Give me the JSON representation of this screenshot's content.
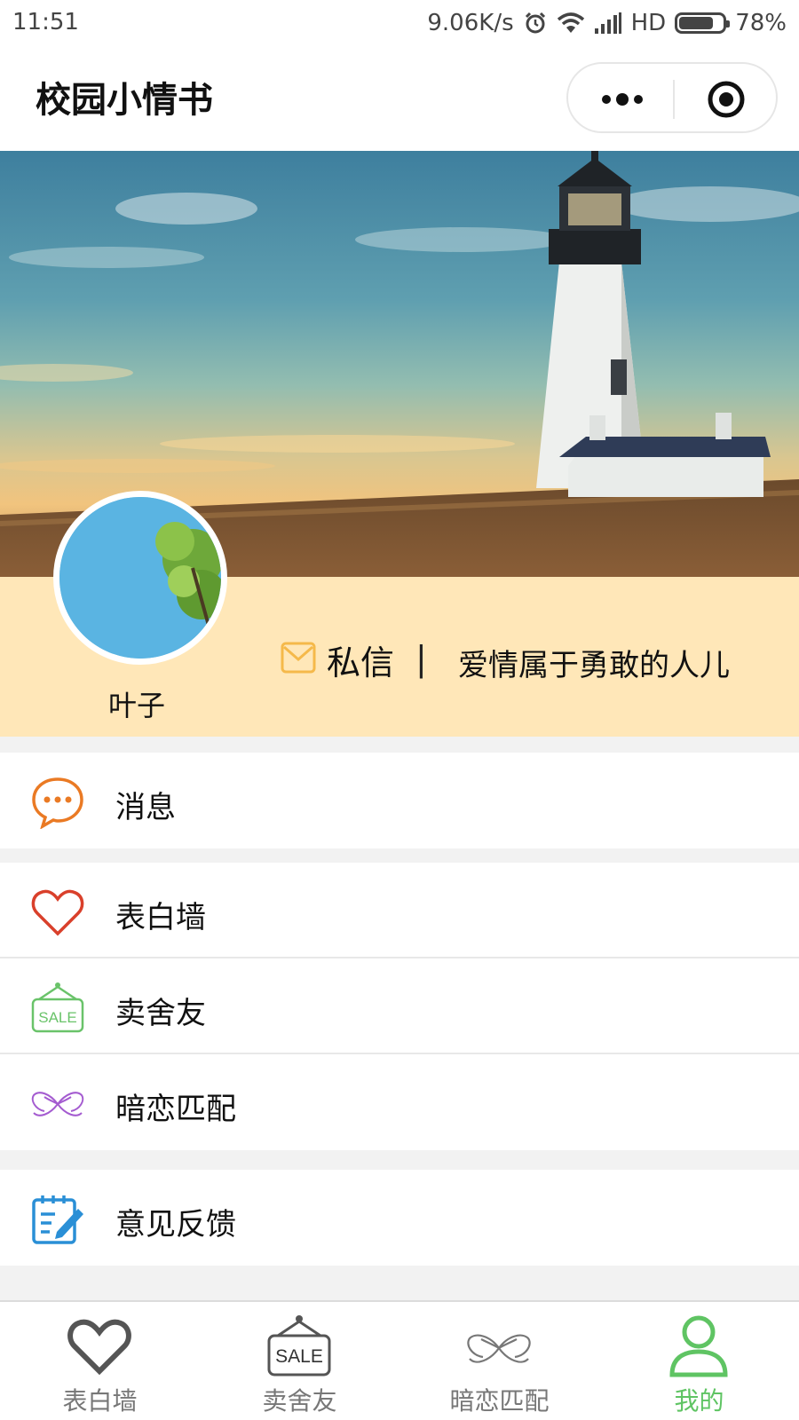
{
  "status_bar": {
    "time": "11:51",
    "network_speed": "9.06K/s",
    "network_type": "HD",
    "battery_percent": "78%",
    "battery_level": 0.78,
    "icons": [
      "alarm-icon",
      "wifi-icon",
      "signal-icon",
      "battery-icon"
    ]
  },
  "nav_bar": {
    "title": "校园小情书",
    "capsule_icons": [
      "more-icon",
      "close-miniprogram-icon"
    ]
  },
  "profile": {
    "name": "叶子",
    "private_message_label": "私信",
    "separator": "|",
    "motto": "爱情属于勇敢的人儿"
  },
  "menu": {
    "groups": [
      [
        {
          "label": "消息",
          "icon": "chat-bubble-icon"
        }
      ],
      [
        {
          "label": "表白墙",
          "icon": "heart-icon"
        },
        {
          "label": "卖舍友",
          "icon": "sale-sign-icon"
        },
        {
          "label": "暗恋匹配",
          "icon": "bow-icon"
        }
      ],
      [
        {
          "label": "意见反馈",
          "icon": "feedback-edit-icon"
        }
      ]
    ]
  },
  "tab_bar": {
    "tabs": [
      {
        "label": "表白墙",
        "icon": "heart-icon",
        "active": false
      },
      {
        "label": "卖舍友",
        "icon": "sale-sign-icon",
        "active": false
      },
      {
        "label": "暗恋匹配",
        "icon": "bow-icon",
        "active": false
      },
      {
        "label": "我的",
        "icon": "person-icon",
        "active": true
      }
    ]
  },
  "colors": {
    "profile_band": "#ffe7b8",
    "tab_active": "#5fc463",
    "tab_inactive": "#777777",
    "message_icon": "#ea7a24",
    "heart_icon": "#d9402b",
    "sale_icon": "#6ac36a",
    "bow_icon": "#a45bd0",
    "feedback_icon": "#2a8fd6",
    "mail_icon": "#f5b94a"
  },
  "sale_text": "SALE"
}
